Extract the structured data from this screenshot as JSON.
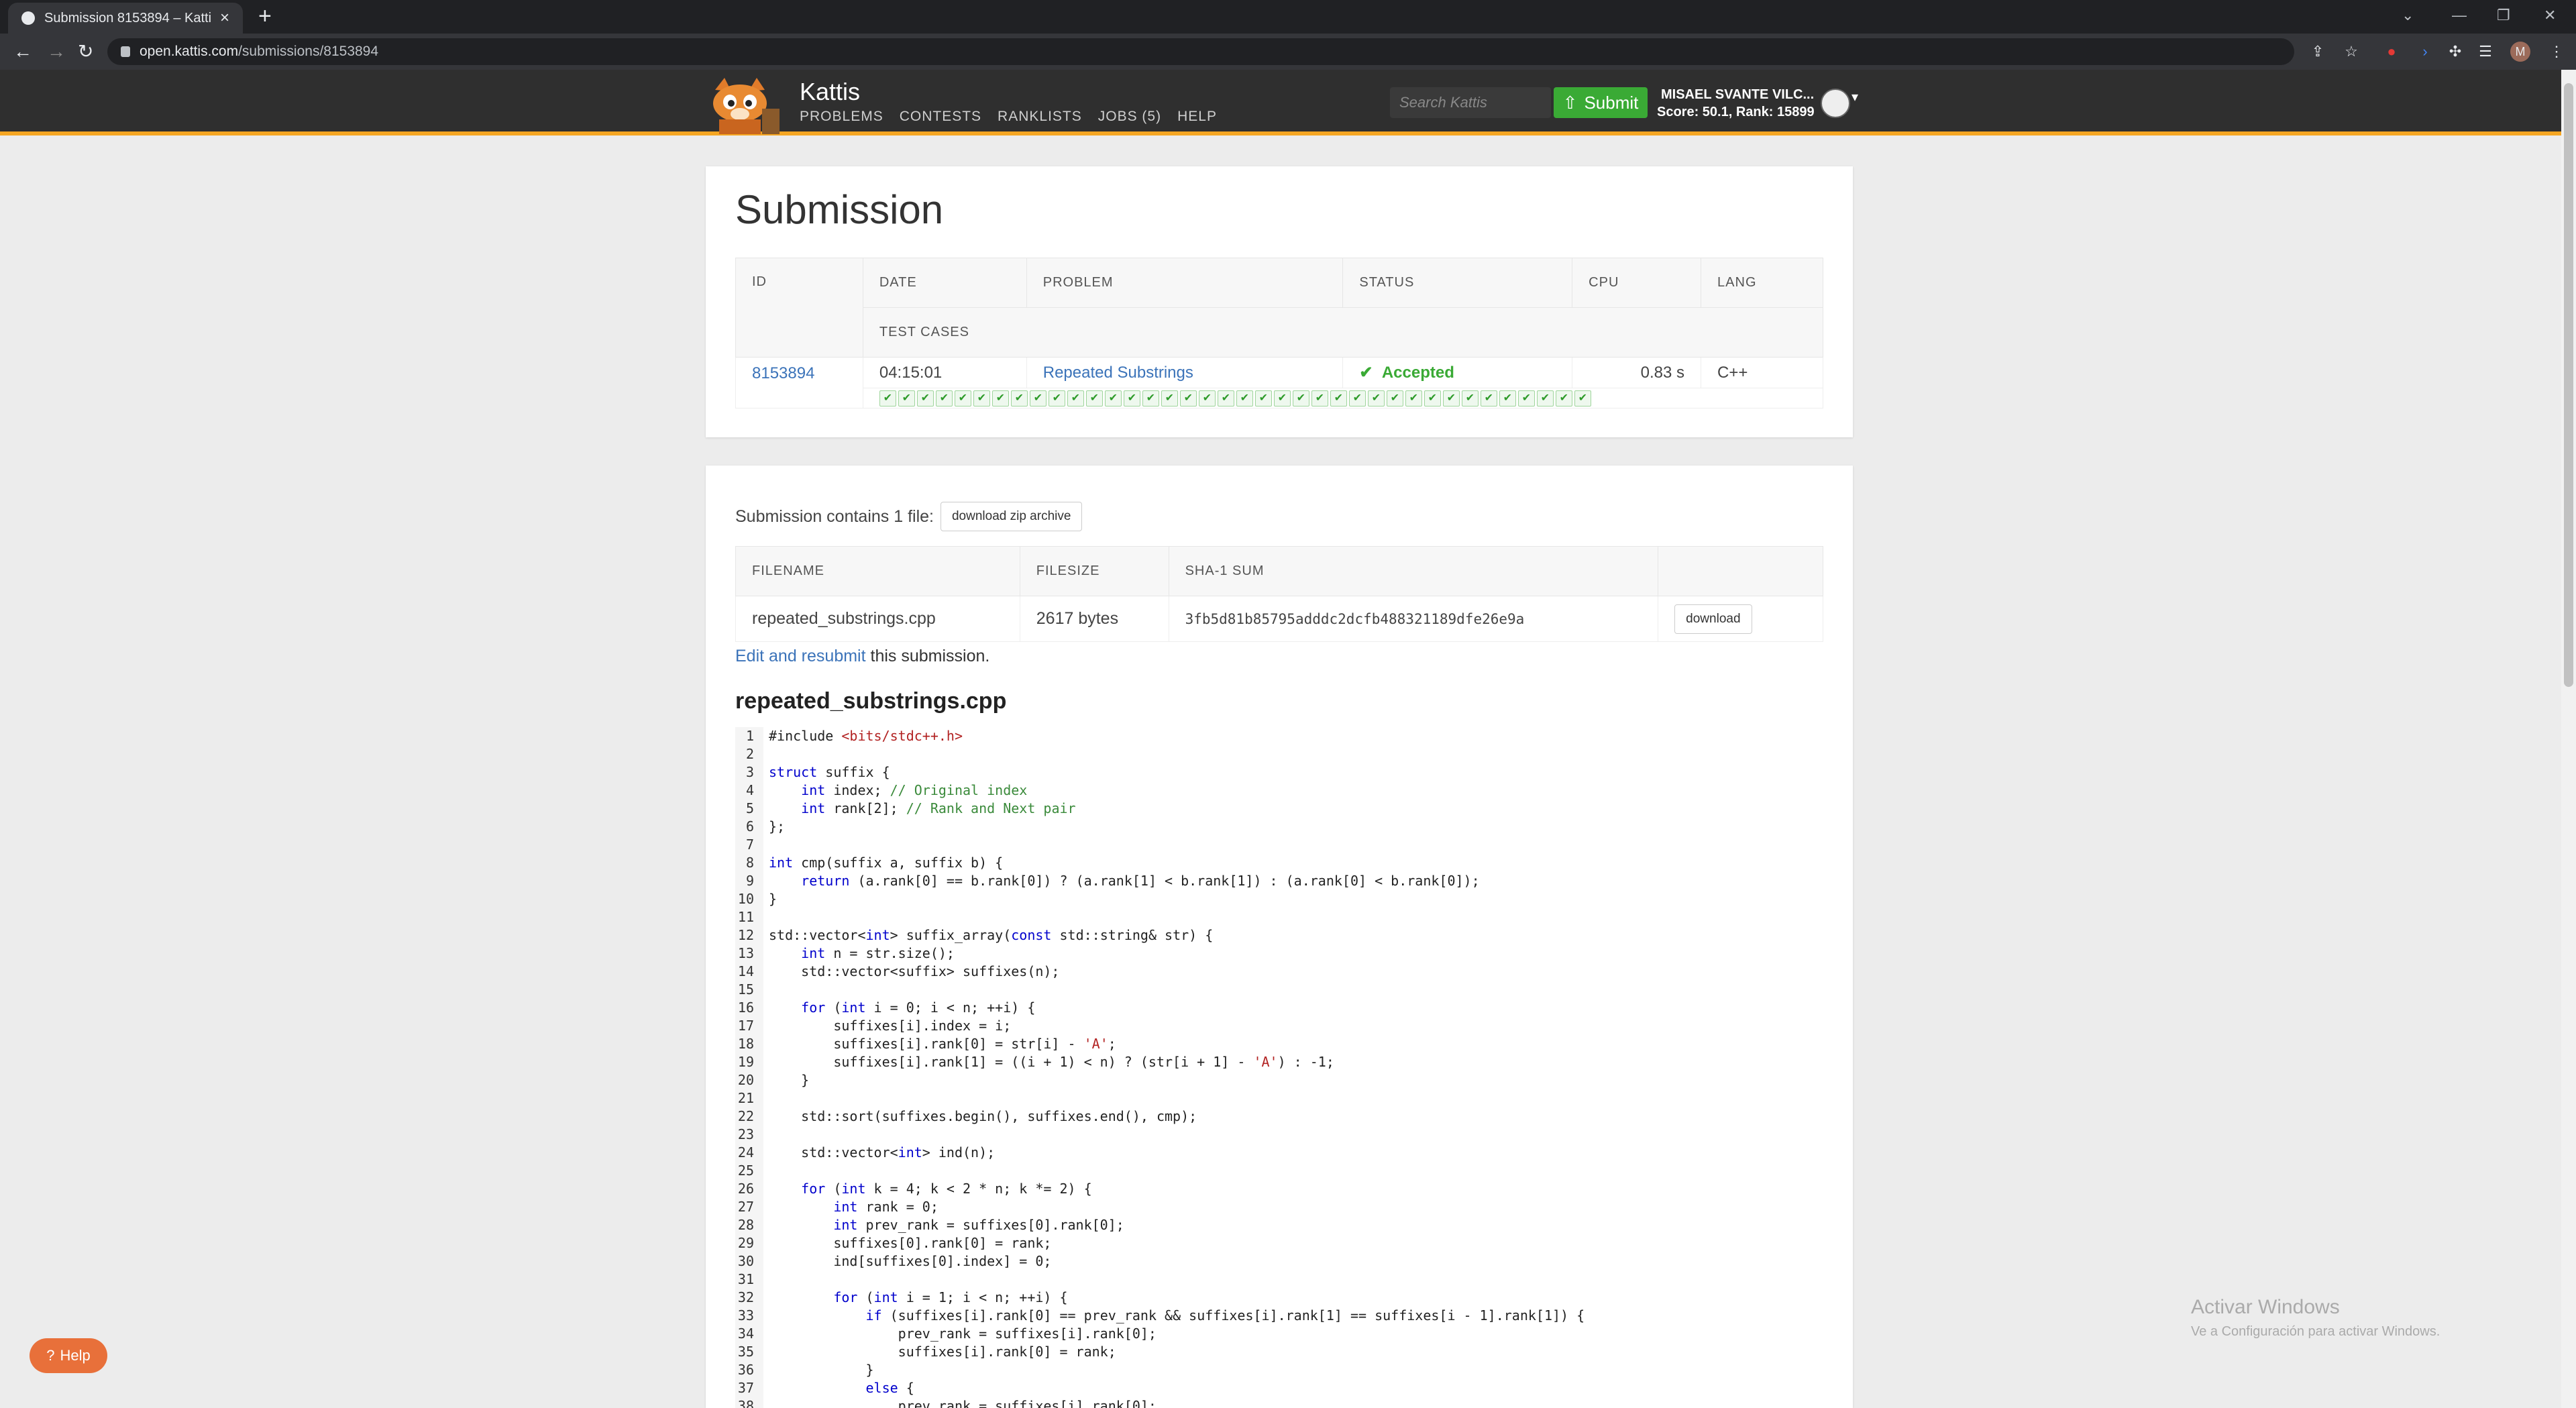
{
  "browser": {
    "tab_title": "Submission 8153894 – Kattis, Kattis",
    "url_host": "open.kattis.com",
    "url_path": "/submissions/8153894"
  },
  "header": {
    "brand": "Kattis",
    "nav": [
      "PROBLEMS",
      "CONTESTS",
      "RANKLISTS",
      "JOBS (5)",
      "HELP"
    ],
    "search_placeholder": "Search Kattis",
    "submit_label": "Submit",
    "user_name": "MISAEL SVANTE VILC...",
    "user_score": "Score: 50.1, Rank: 15899"
  },
  "colors": {
    "accent": "#f5a623",
    "submit": "#3aaa35",
    "link": "#3b73b9",
    "accepted": "#3aaa35"
  },
  "submission": {
    "title": "Submission",
    "headers": {
      "id": "ID",
      "date": "DATE",
      "problem": "PROBLEM",
      "status": "STATUS",
      "cpu": "CPU",
      "lang": "LANG",
      "test_cases": "TEST CASES"
    },
    "row": {
      "id": "8153894",
      "date": "04:15:01",
      "problem": "Repeated Substrings",
      "status": "Accepted",
      "cpu": "0.83 s",
      "lang": "C++"
    },
    "test_cases_passed": 38
  },
  "files": {
    "contains_text": "Submission contains 1 file:",
    "zip_button": "download zip archive",
    "headers": {
      "filename": "FILENAME",
      "filesize": "FILESIZE",
      "sha": "SHA-1 SUM"
    },
    "row": {
      "filename": "repeated_substrings.cpp",
      "filesize": "2617 bytes",
      "sha": "3fb5d81b85795adddc2dcfb488321189dfe26e9a",
      "download": "download"
    },
    "edit_link": "Edit and resubmit",
    "edit_rest": " this submission.",
    "code_title": "repeated_substrings.cpp"
  },
  "code_lines": [
    "#include <bits/stdc++.h>",
    "",
    "struct suffix {",
    "    int index; // Original index",
    "    int rank[2]; // Rank and Next pair",
    "};",
    "",
    "int cmp(suffix a, suffix b) {",
    "    return (a.rank[0] == b.rank[0]) ? (a.rank[1] < b.rank[1]) : (a.rank[0] < b.rank[0]);",
    "}",
    "",
    "std::vector<int> suffix_array(const std::string& str) {",
    "    int n = str.size();",
    "    std::vector<suffix> suffixes(n);",
    "",
    "    for (int i = 0; i < n; ++i) {",
    "        suffixes[i].index = i;",
    "        suffixes[i].rank[0] = str[i] - 'A';",
    "        suffixes[i].rank[1] = ((i + 1) < n) ? (str[i + 1] - 'A') : -1;",
    "    }",
    "",
    "    std::sort(suffixes.begin(), suffixes.end(), cmp);",
    "",
    "    std::vector<int> ind(n);",
    "",
    "    for (int k = 4; k < 2 * n; k *= 2) {",
    "        int rank = 0;",
    "        int prev_rank = suffixes[0].rank[0];",
    "        suffixes[0].rank[0] = rank;",
    "        ind[suffixes[0].index] = 0;",
    "",
    "        for (int i = 1; i < n; ++i) {",
    "            if (suffixes[i].rank[0] == prev_rank && suffixes[i].rank[1] == suffixes[i - 1].rank[1]) {",
    "                prev_rank = suffixes[i].rank[0];",
    "                suffixes[i].rank[0] = rank;",
    "            }",
    "            else {",
    "                prev_rank = suffixes[i].rank[0];"
  ],
  "help_label": "Help",
  "watermark": {
    "line1": "Activar Windows",
    "line2": "Ve a Configuración para activar Windows."
  }
}
